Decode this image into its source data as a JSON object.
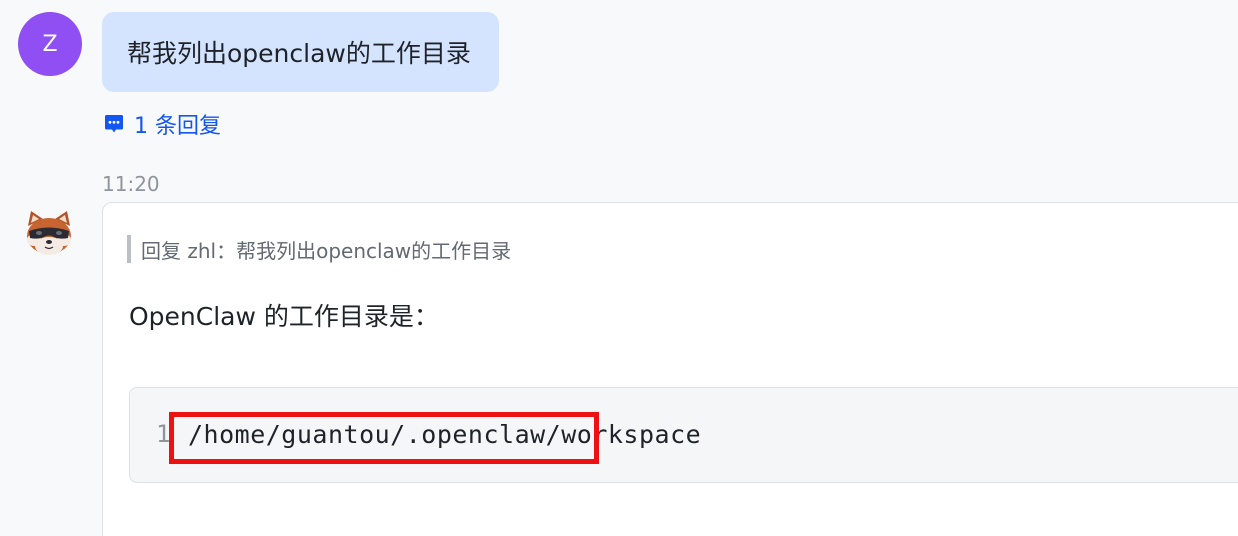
{
  "user_message": {
    "avatar_initial": "Z",
    "avatar_color": "#8f4ff2",
    "text": "帮我列出openclaw的工作目录",
    "bubble_color": "#d4e4ff"
  },
  "thread": {
    "icon": "comment-icon",
    "reply_count_label": "1 条回复"
  },
  "bot_message": {
    "time": "11:20",
    "avatar": "red-panda-icon",
    "quote_text": "回复 zhl：帮我列出openclaw的工作目录",
    "answer_text": "OpenClaw 的工作目录是：",
    "code": {
      "line_number": "1",
      "content": "/home/guantou/.openclaw/workspace"
    }
  },
  "annotation": {
    "color": "#ee1111"
  }
}
